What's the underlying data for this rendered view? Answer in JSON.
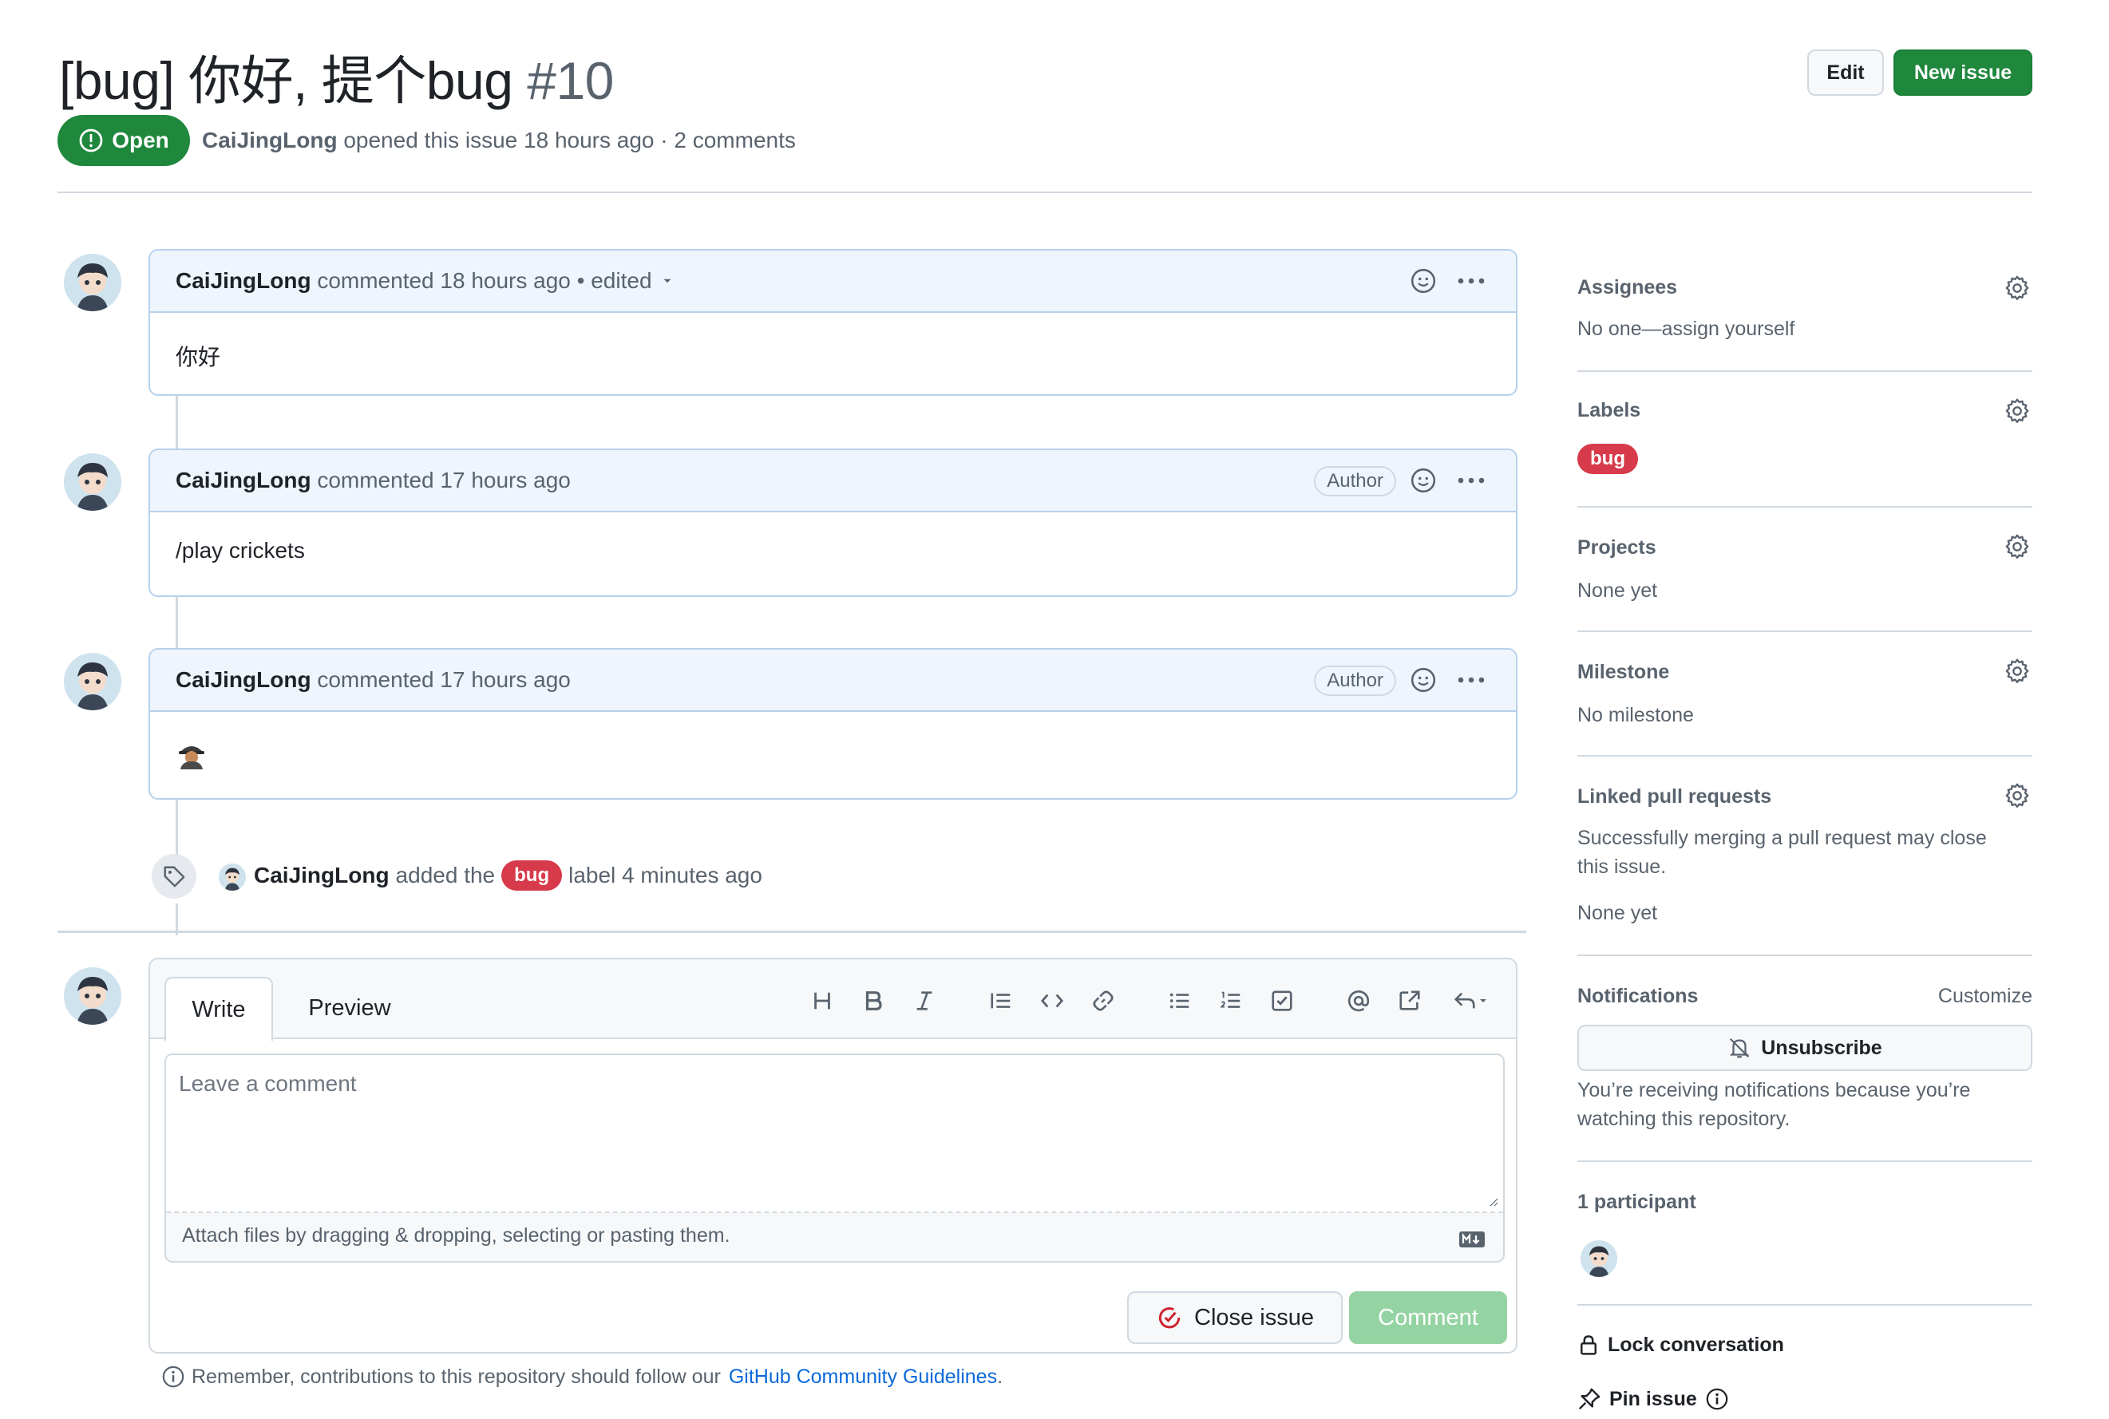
{
  "header": {
    "title": "[bug] 你好, 提个bug",
    "number": "#10",
    "edit_label": "Edit",
    "new_issue_label": "New issue",
    "state": "Open",
    "author": "CaiJingLong",
    "opened_text": "opened this issue 18 hours ago · 2 comments"
  },
  "comments": [
    {
      "author": "CaiJingLong",
      "meta": "commented 18 hours ago",
      "edited": "• edited",
      "badge": "",
      "body": "你好"
    },
    {
      "author": "CaiJingLong",
      "meta": "commented 17 hours ago",
      "edited": "",
      "badge": "Author",
      "body": "/play crickets"
    },
    {
      "author": "CaiJingLong",
      "meta": "commented 17 hours ago",
      "edited": "",
      "badge": "Author",
      "body": ""
    }
  ],
  "event": {
    "actor": "CaiJingLong",
    "pre": "added the",
    "label": "bug",
    "post": "label 4 minutes ago"
  },
  "composer": {
    "tab_write": "Write",
    "tab_preview": "Preview",
    "placeholder": "Leave a comment",
    "attach_text": "Attach files by dragging & dropping, selecting or pasting them.",
    "close_issue_label": "Close issue",
    "comment_label": "Comment",
    "footer_pre": "Remember, contributions to this repository should follow our",
    "footer_link": "GitHub Community Guidelines",
    "footer_post": "."
  },
  "sidebar": {
    "assignees_title": "Assignees",
    "assignees_value": "No one—assign yourself",
    "labels_title": "Labels",
    "labels_value": "bug",
    "projects_title": "Projects",
    "projects_value": "None yet",
    "milestone_title": "Milestone",
    "milestone_value": "No milestone",
    "linked_title": "Linked pull requests",
    "linked_desc_1": "Successfully merging a pull request may close",
    "linked_desc_2": "this issue.",
    "linked_value": "None yet",
    "notifications_title": "Notifications",
    "customize_label": "Customize",
    "unsubscribe_label": "Unsubscribe",
    "notif_desc_1": "You’re receiving notifications because you’re",
    "notif_desc_2": "watching this repository.",
    "participants_title": "1 participant",
    "lock_label": "Lock conversation",
    "pin_label": "Pin issue"
  },
  "colors": {
    "green": "#1f883d",
    "label_red": "#d73a4a",
    "comment_blue": "#eef5fd",
    "link_blue": "#0969da"
  }
}
